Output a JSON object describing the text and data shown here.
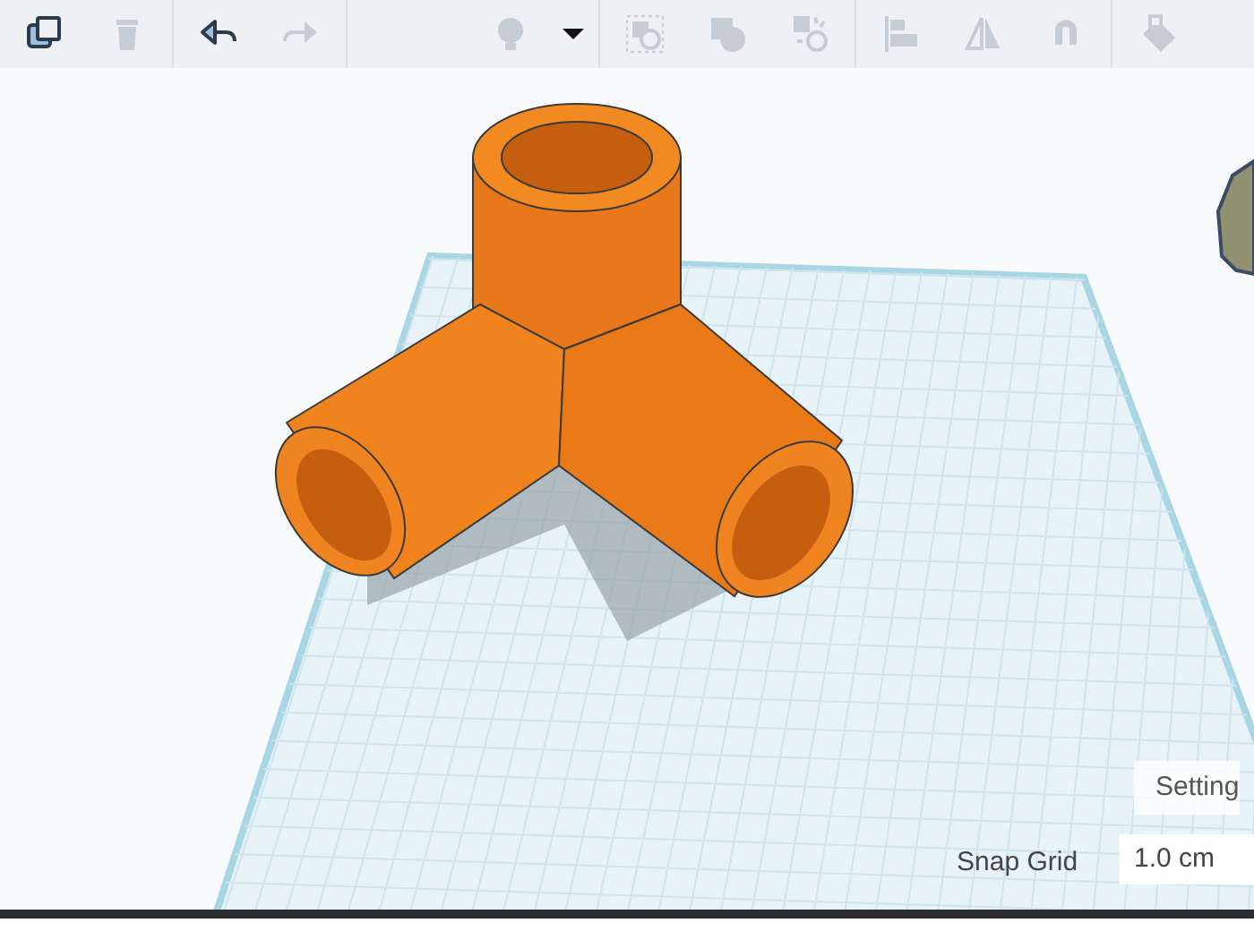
{
  "toolbar": {
    "tools": [
      {
        "kind": "copy",
        "disabled": false
      },
      {
        "kind": "trash",
        "disabled": true
      },
      {
        "kind": "separator"
      },
      {
        "kind": "undo",
        "disabled": false
      },
      {
        "kind": "redo",
        "disabled": true
      },
      {
        "kind": "separator"
      },
      {
        "kind": "spacer"
      },
      {
        "kind": "bulb",
        "disabled": true
      },
      {
        "kind": "caret",
        "disabled": false
      },
      {
        "kind": "separator"
      },
      {
        "kind": "group",
        "disabled": true
      },
      {
        "kind": "solid",
        "disabled": true
      },
      {
        "kind": "hole",
        "disabled": true
      },
      {
        "kind": "separator"
      },
      {
        "kind": "align",
        "disabled": true
      },
      {
        "kind": "mirror",
        "disabled": true
      },
      {
        "kind": "magnet",
        "disabled": true
      },
      {
        "kind": "separator"
      },
      {
        "kind": "paint",
        "disabled": true
      }
    ]
  },
  "viewport": {
    "settings_button": "Setting",
    "snap_grid": {
      "label": "Snap Grid",
      "value": "1.0 cm"
    }
  }
}
